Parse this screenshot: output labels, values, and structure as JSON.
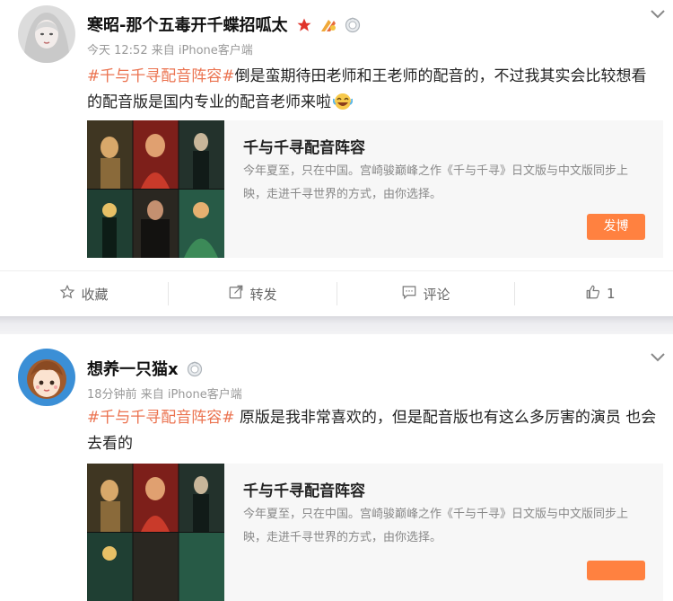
{
  "posts": [
    {
      "username": "寒昭-那个五毒开千蝶招呱太",
      "time": "今天 12:52",
      "source_prefix": "来自",
      "source": "iPhone客户端",
      "hashtag": "#千与千寻配音阵容#",
      "text": "倒是蛮期待田老师和王老师的配音的，不过我其实会比较想看的配音版是国内专业的配音老师来啦",
      "card": {
        "title": "千与千寻配音阵容",
        "desc": "今年夏至，只在中国。宫崎骏巅峰之作《千与千寻》日文版与中文版同步上映，走进千寻世界的方式，由你选择。",
        "button": "发博"
      },
      "actions": {
        "favorite": "收藏",
        "repost": "转发",
        "comment": "评论",
        "like": "1"
      }
    },
    {
      "username": "想养一只猫x",
      "time": "18分钟前",
      "source_prefix": "来自",
      "source": "iPhone客户端",
      "hashtag": "#千与千寻配音阵容#",
      "text": " 原版是我非常喜欢的，但是配音版也有这么多厉害的演员 也会去看的",
      "card": {
        "title": "千与千寻配音阵容",
        "desc": "今年夏至，只在中国。宫崎骏巅峰之作《千与千寻》日文版与中文版同步上映，走进千寻世界的方式，由你选择。"
      }
    }
  ],
  "colors": {
    "accent": "#eb7350",
    "button": "#ff8140",
    "card_bg": "#f7f7f7"
  },
  "icons": [
    "chevron-down-icon",
    "star-icon",
    "badge-icon",
    "level-icon",
    "laugh-emoji-icon",
    "favorite-icon",
    "repost-icon",
    "comment-icon",
    "like-icon"
  ]
}
